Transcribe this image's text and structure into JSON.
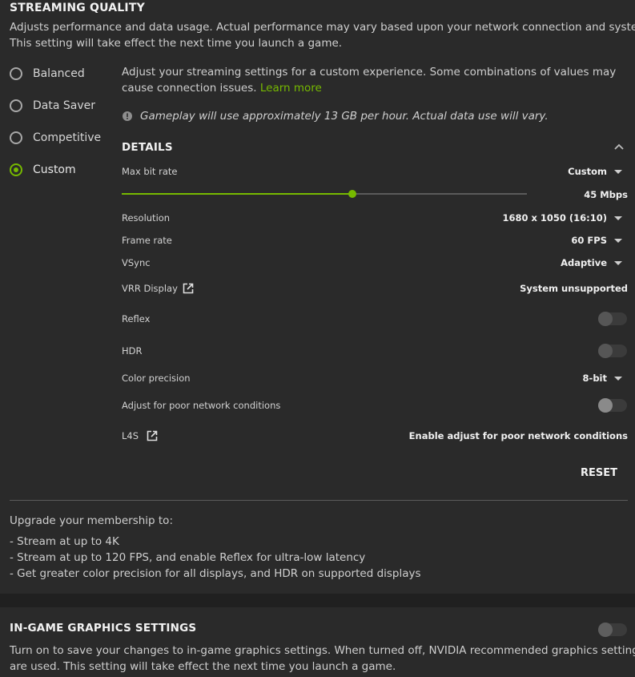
{
  "streaming_quality": {
    "title": "STREAMING QUALITY",
    "description_line1": "Adjusts performance and data usage. Actual performance may vary based upon your network connection and system.",
    "description_line2": "This setting will take effect the next time you launch a game.",
    "presets": [
      {
        "label": "Balanced",
        "selected": false
      },
      {
        "label": "Data Saver",
        "selected": false
      },
      {
        "label": "Competitive",
        "selected": false
      },
      {
        "label": "Custom",
        "selected": true
      }
    ],
    "custom_info_line1": "Adjust your streaming settings for a custom experience. Some combinations of values may",
    "custom_info_line2": "cause connection issues.",
    "learn_more": "Learn more",
    "data_usage_note": "Gameplay will use approximately 13 GB per hour. Actual data use will vary.",
    "details": {
      "heading": "DETAILS",
      "max_bit_rate": {
        "label": "Max bit rate",
        "mode": "Custom",
        "value": "45 Mbps",
        "slider_fraction": 0.57
      },
      "resolution": {
        "label": "Resolution",
        "value": "1680 x 1050 (16:10)"
      },
      "frame_rate": {
        "label": "Frame rate",
        "value": "60 FPS"
      },
      "vsync": {
        "label": "VSync",
        "value": "Adaptive"
      },
      "vrr_display": {
        "label": "VRR Display",
        "value": "System unsupported"
      },
      "reflex": {
        "label": "Reflex",
        "enabled": false
      },
      "hdr": {
        "label": "HDR",
        "enabled": false
      },
      "color_precision": {
        "label": "Color precision",
        "value": "8-bit"
      },
      "poor_network": {
        "label": "Adjust for poor network conditions",
        "enabled": false
      },
      "l4s": {
        "label": "L4S",
        "value": "Enable adjust for poor network conditions"
      }
    },
    "reset_label": "RESET",
    "upgrade": {
      "heading": "Upgrade your membership to:",
      "items": [
        "- Stream at up to 4K",
        "- Stream at up to 120 FPS, and enable Reflex for ultra-low latency",
        "- Get greater color precision for all displays, and HDR on supported displays"
      ]
    }
  },
  "in_game_graphics": {
    "title": "IN-GAME GRAPHICS SETTINGS",
    "enabled": false,
    "description_line1": "Turn on to save your changes to in-game graphics settings. When turned off, NVIDIA recommended graphics settings",
    "description_line2": "are used. This setting will take effect the next time you launch a game."
  },
  "colors": {
    "accent": "#76b900",
    "background": "#2a2a2a",
    "separator": "#202020"
  }
}
